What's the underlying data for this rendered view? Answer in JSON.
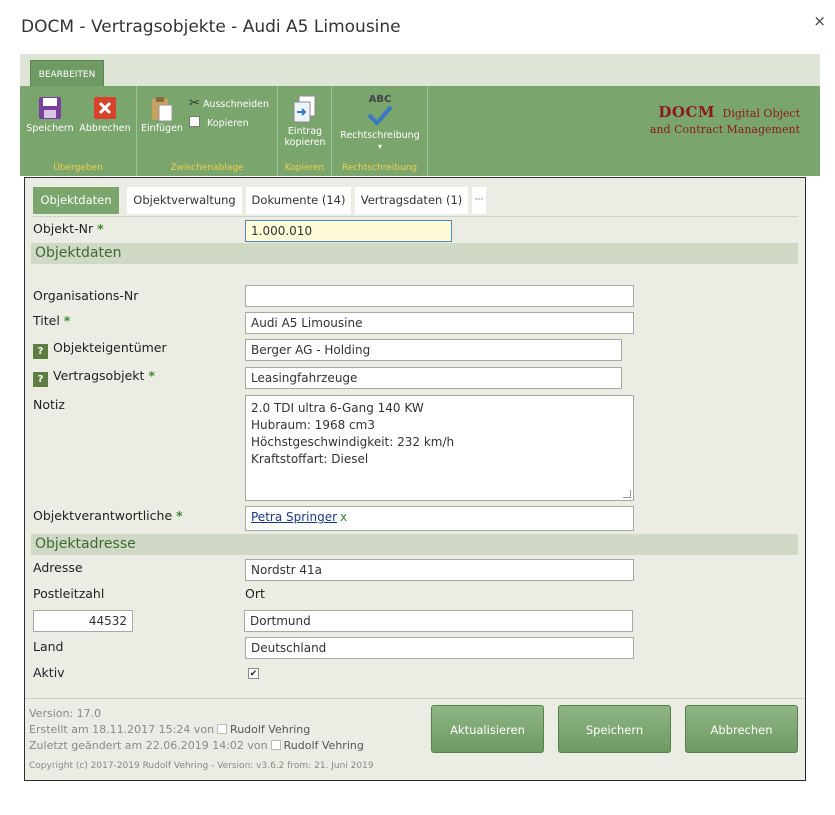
{
  "window": {
    "title": "DOCM - Vertragsobjekte - Audi A5 Limousine",
    "close": "×"
  },
  "ribbon": {
    "tab": "BEARBEITEN",
    "groups": {
      "uebergeben": "Übergeben",
      "zwischenablage": "Zwischenablage",
      "kopieren": "Kopieren",
      "rechtschreibung": "Rechtschreibung"
    },
    "buttons": {
      "speichern": "Speichern",
      "abbrechen": "Abbrechen",
      "einfuegen": "Einfügen",
      "ausschneiden": "Ausschneiden",
      "kopieren": "Kopieren",
      "eintrag_kopieren_1": "Eintrag",
      "eintrag_kopieren_2": "kopieren",
      "rechtschreibung": "Rechtschreibung",
      "abc": "ABC"
    },
    "brand": {
      "name": "DOCM",
      "line1": "Digital Object",
      "line2": "and Contract Management"
    }
  },
  "tabs": [
    {
      "label": "Objektdaten",
      "active": true
    },
    {
      "label": "Objektverwaltung"
    },
    {
      "label": "Dokumente (14)"
    },
    {
      "label": "Vertragsdaten (1)"
    },
    {
      "label": "···"
    }
  ],
  "form": {
    "objekt_nr": {
      "label": "Objekt-Nr",
      "value": "1.000.010"
    },
    "section_objektdaten": "Objektdaten",
    "organisations_nr": {
      "label": "Organisations-Nr",
      "value": ""
    },
    "titel": {
      "label": "Titel",
      "value": "Audi A5 Limousine"
    },
    "objekteigentuemer": {
      "label": "Objekteigentümer",
      "value": "Berger AG - Holding"
    },
    "vertragsobjekt": {
      "label": "Vertragsobjekt",
      "value": "Leasingfahrzeuge"
    },
    "notiz": {
      "label": "Notiz",
      "lines": [
        "2.0 TDI ultra 6-Gang 140 KW",
        "Hubraum: 1968 cm3",
        "Höchstgeschwindigkeit: 232 km/h",
        "Kraftstoffart: Diesel"
      ]
    },
    "objektverantwortliche": {
      "label": "Objektverantwortliche",
      "value": "Petra Springer",
      "remove": "x"
    },
    "section_objektadresse": "Objektadresse",
    "adresse": {
      "label": "Adresse",
      "value": "Nordstr 41a"
    },
    "postleitzahl": {
      "label": "Postleitzahl",
      "value": "44532"
    },
    "ort": {
      "label": "Ort",
      "value": "Dortmund"
    },
    "land": {
      "label": "Land",
      "value": "Deutschland"
    },
    "aktiv": {
      "label": "Aktiv",
      "checked": true,
      "mark": "✔"
    },
    "required_mark": "*",
    "help_mark": "?"
  },
  "footer": {
    "version": "Version: 17.0",
    "created_prefix": "Erstellt am 18.11.2017 15:24  von",
    "created_user": "Rudolf Vehring",
    "modified_prefix": "Zuletzt geändert am 22.06.2019 14:02  von",
    "modified_user": "Rudolf Vehring",
    "copyright": "Copyright (c) 2017-2019 Rudolf Vehring - Version: v3.6.2 from: 21. Juni 2019"
  },
  "actions": {
    "aktualisieren": "Aktualisieren",
    "speichern": "Speichern",
    "abbrechen": "Abbrechen"
  },
  "colors": {
    "ribbon": "#7aa56d",
    "accent_green": "#3a8a2a",
    "brand_red": "#8b1a1a",
    "group_label": "#f0d04a"
  }
}
